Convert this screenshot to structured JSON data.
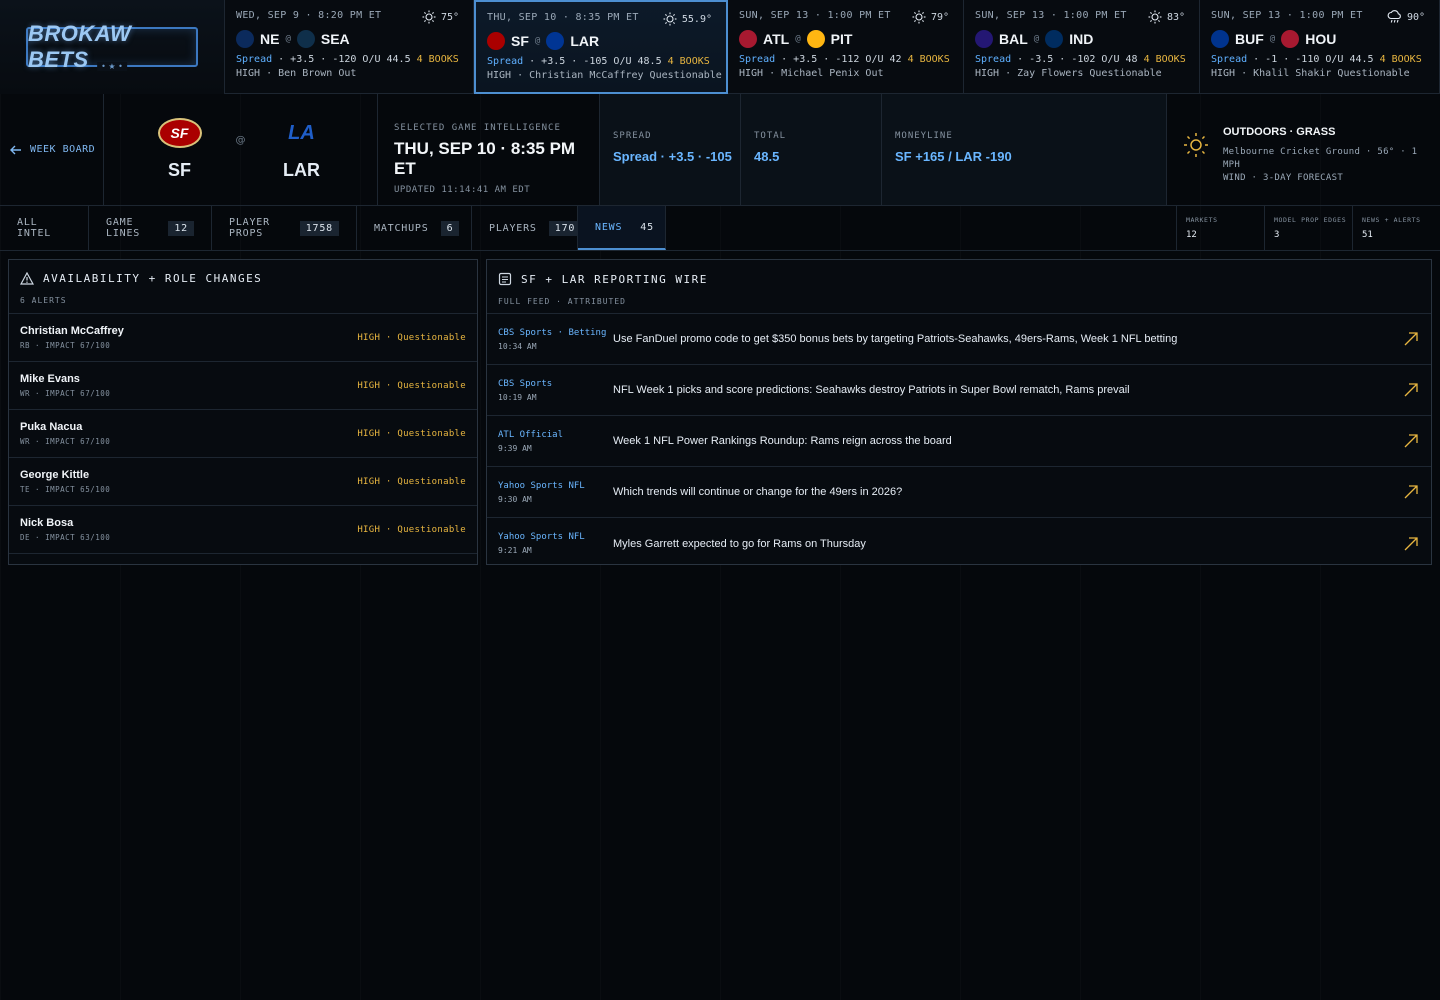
{
  "brand": {
    "name": "BROKAW BETS",
    "sub": "• ★ •"
  },
  "games": [
    {
      "date": "WED, SEP 9 · 8:20 PM ET",
      "weather_icon": "sun-icon",
      "temp": "75°",
      "away": "NE",
      "home": "SEA",
      "at": "@",
      "spread_label": "Spread",
      "line": " · +3.5 · -120 O/U 44.5 ",
      "books": "4 BOOKS",
      "note": "HIGH · Ben Brown Out",
      "away_color": "#0b2a5c",
      "home_color": "#0f2f4a",
      "selected": false
    },
    {
      "date": "THU, SEP 10 · 8:35 PM ET",
      "weather_icon": "sun-icon",
      "temp": "55.9°",
      "away": "SF",
      "home": "LAR",
      "at": "@",
      "spread_label": "Spread",
      "line": " · +3.5 · -105 O/U 48.5 ",
      "books": "4 BOOKS",
      "note": "HIGH · Christian McCaffrey Questionable",
      "away_color": "#aa0000",
      "home_color": "#003594",
      "selected": true
    },
    {
      "date": "SUN, SEP 13 · 1:00 PM ET",
      "weather_icon": "sun-icon",
      "temp": "79°",
      "away": "ATL",
      "home": "PIT",
      "at": "@",
      "spread_label": "Spread",
      "line": " · +3.5 · -112 O/U 42 ",
      "books": "4 BOOKS",
      "note": "HIGH · Michael Penix Out",
      "away_color": "#a71930",
      "home_color": "#ffb612",
      "selected": false
    },
    {
      "date": "SUN, SEP 13 · 1:00 PM ET",
      "weather_icon": "sun-icon",
      "temp": "83°",
      "away": "BAL",
      "home": "IND",
      "at": "@",
      "spread_label": "Spread",
      "line": " · -3.5 · -102 O/U 48 ",
      "books": "4 BOOKS",
      "note": "HIGH · Zay Flowers Questionable",
      "away_color": "#241773",
      "home_color": "#002c5f",
      "selected": false
    },
    {
      "date": "SUN, SEP 13 · 1:00 PM ET",
      "weather_icon": "rain-cloud-icon",
      "temp": "90°",
      "away": "BUF",
      "home": "HOU",
      "at": "@",
      "spread_label": "Spread",
      "line": " · -1 · -110 O/U 44.5 ",
      "books": "4 BOOKS",
      "note": "HIGH · Khalil Shakir Questionable",
      "away_color": "#00338d",
      "home_color": "#a71930",
      "selected": false
    }
  ],
  "header": {
    "back_label": "WEEK BOARD",
    "away": "SF",
    "home": "LAR",
    "at": "@",
    "away_color": "#aa0000",
    "home_color": "#003594",
    "intel_label": "SELECTED GAME INTELLIGENCE",
    "intel_title": "THU, SEP 10 · 8:35 PM ET",
    "updated": "UPDATED 11:14:41 AM EDT",
    "spread_label": "SPREAD",
    "spread_value": "Spread · +3.5 · -105",
    "total_label": "TOTAL",
    "total_value": "48.5",
    "moneyline_label": "MONEYLINE",
    "moneyline_value": "SF +165 / LAR -190",
    "venue_title": "OUTDOORS · GRASS",
    "venue_line1": "Melbourne Cricket Ground · 56° · 1 MPH",
    "venue_line2": "WIND · 3-DAY FORECAST"
  },
  "tabs": [
    {
      "label": "ALL INTEL",
      "count": ""
    },
    {
      "label": "GAME LINES",
      "count": "12"
    },
    {
      "label": "PLAYER PROPS",
      "count": "1758"
    },
    {
      "label": "MATCHUPS",
      "count": "6"
    },
    {
      "label": "PLAYERS",
      "count": "170"
    },
    {
      "label": "NEWS",
      "count": "45",
      "active": true
    }
  ],
  "kpis": [
    {
      "label": "MARKETS",
      "value": "12"
    },
    {
      "label": "MODEL PROP EDGES",
      "value": "3"
    },
    {
      "label": "NEWS + ALERTS",
      "value": "51"
    }
  ],
  "availability": {
    "title": "AVAILABILITY + ROLE CHANGES",
    "sub": "6 ALERTS",
    "items": [
      {
        "name": "Christian McCaffrey",
        "meta": "RB · IMPACT 67/100",
        "status": "HIGH · Questionable"
      },
      {
        "name": "Mike Evans",
        "meta": "WR · IMPACT 67/100",
        "status": "HIGH · Questionable"
      },
      {
        "name": "Puka Nacua",
        "meta": "WR · IMPACT 67/100",
        "status": "HIGH · Questionable"
      },
      {
        "name": "George Kittle",
        "meta": "TE · IMPACT 65/100",
        "status": "HIGH · Questionable"
      },
      {
        "name": "Nick Bosa",
        "meta": "DE · IMPACT 63/100",
        "status": "HIGH · Questionable"
      }
    ]
  },
  "wire": {
    "title": "SF + LAR REPORTING WIRE",
    "sub": "FULL FEED · ATTRIBUTED",
    "items": [
      {
        "source": "CBS Sports · Betting",
        "time": "10:34 AM",
        "headline": "Use FanDuel promo code to get $350 bonus bets by targeting Patriots-Seahawks, 49ers-Rams, Week 1 NFL betting"
      },
      {
        "source": "CBS Sports",
        "time": "10:19 AM",
        "headline": "NFL Week 1 picks and score predictions: Seahawks destroy Patriots in Super Bowl rematch, Rams prevail"
      },
      {
        "source": "ATL Official",
        "time": "9:39 AM",
        "headline": "Week 1 NFL Power Rankings Roundup: Rams reign across the board"
      },
      {
        "source": "Yahoo Sports NFL",
        "time": "9:30 AM",
        "headline": "Which trends will continue or change for the 49ers in 2026?"
      },
      {
        "source": "Yahoo Sports NFL",
        "time": "9:21 AM",
        "headline": "Myles Garrett expected to go for Rams on Thursday"
      }
    ]
  },
  "colors": {
    "accent": "#4d8fd1",
    "link": "#6ab6ff",
    "warning": "#e8b640",
    "bg": "#05080c"
  }
}
